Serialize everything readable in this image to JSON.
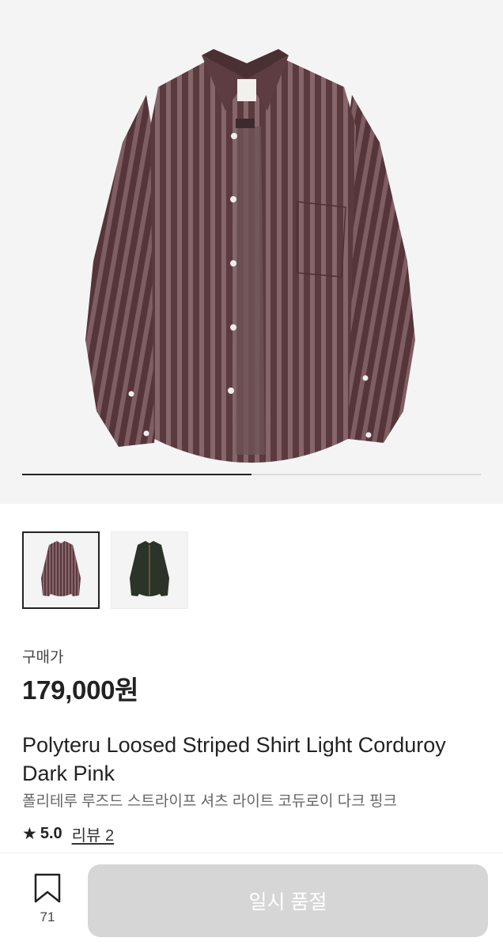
{
  "gallery": {
    "progress": 0.5,
    "image_alt": "striped-corduroy-shirt",
    "shirt_color": "#5a3a3f",
    "stripe_color": "#8a6a6e",
    "thumbnails": [
      {
        "name": "thumb-dark-pink",
        "color": "#5a3a3f",
        "selected": true
      },
      {
        "name": "thumb-dark-green",
        "color": "#2c3328",
        "selected": false
      }
    ]
  },
  "price": {
    "label": "구매가",
    "value": "179,000원"
  },
  "product": {
    "title": "Polyteru Loosed Striped Shirt Light Corduroy Dark Pink",
    "subtitle": "폴리테루 루즈드 스트라이프 셔츠 라이트 코듀로이 다크 핑크"
  },
  "rating": {
    "icon": "star-icon",
    "value": "5.0",
    "reviews_label": "리뷰 2"
  },
  "footer": {
    "bookmark_icon": "bookmark-icon",
    "bookmark_count": "71",
    "soldout_label": "일시 품절"
  }
}
